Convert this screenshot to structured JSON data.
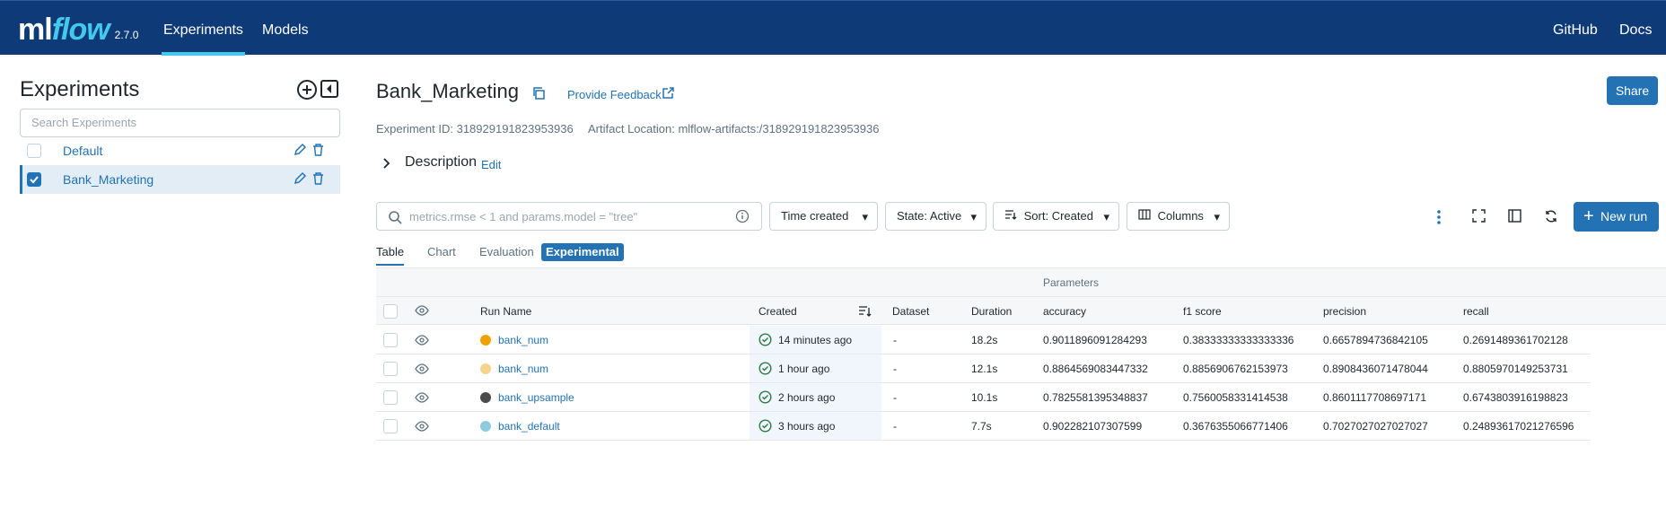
{
  "header": {
    "logo_ml": "ml",
    "logo_flow": "flow",
    "version": "2.7.0",
    "tabs": [
      {
        "label": "Experiments"
      },
      {
        "label": "Models"
      }
    ],
    "right_links": [
      {
        "label": "GitHub"
      },
      {
        "label": "Docs"
      }
    ]
  },
  "sidebar": {
    "title": "Experiments",
    "search_placeholder": "Search Experiments",
    "items": [
      {
        "label": "Default",
        "checked": false
      },
      {
        "label": "Bank_Marketing",
        "checked": true
      }
    ]
  },
  "experiment": {
    "title": "Bank_Marketing",
    "feedback_label": "Provide Feedback",
    "share_label": "Share",
    "id_text": "Experiment ID: 318929191823953936",
    "artifact_text": "Artifact Location: mlflow-artifacts:/318929191823953936",
    "description_label": "Description",
    "edit_label": "Edit"
  },
  "toolbar": {
    "search_placeholder": "metrics.rmse < 1 and params.model = \"tree\"",
    "time_created": "Time created",
    "state": "State: Active",
    "sort": "Sort: Created",
    "columns": "Columns",
    "new_run": "New run"
  },
  "view_tabs": {
    "table": "Table",
    "chart": "Chart",
    "evaluation": "Evaluation",
    "experimental": "Experimental"
  },
  "table": {
    "group_label": "Parameters",
    "headers": {
      "run_name": "Run Name",
      "created": "Created",
      "dataset": "Dataset",
      "duration": "Duration",
      "accuracy": "accuracy",
      "f1": "f1 score",
      "precision": "precision",
      "recall": "recall"
    },
    "rows": [
      {
        "name": "bank_num",
        "color": "#f2a200",
        "created": "14 minutes ago",
        "dataset": "-",
        "duration": "18.2s",
        "accuracy": "0.9011896091284293",
        "f1": "0.38333333333333336",
        "precision": "0.6657894736842105",
        "recall": "0.2691489361702128"
      },
      {
        "name": "bank_num",
        "color": "#f7d48e",
        "created": "1 hour ago",
        "dataset": "-",
        "duration": "12.1s",
        "accuracy": "0.8864569083447332",
        "f1": "0.8856906762153973",
        "precision": "0.8908436071478044",
        "recall": "0.8805970149253731"
      },
      {
        "name": "bank_upsample",
        "color": "#4a4a4a",
        "created": "2 hours ago",
        "dataset": "-",
        "duration": "10.1s",
        "accuracy": "0.7825581395348837",
        "f1": "0.7560058331414538",
        "precision": "0.8601117708697171",
        "recall": "0.6743803916198823"
      },
      {
        "name": "bank_default",
        "color": "#8ccbe0",
        "created": "3 hours ago",
        "dataset": "-",
        "duration": "7.7s",
        "accuracy": "0.902282107307599",
        "f1": "0.3676355066771406",
        "precision": "0.7027027027027027",
        "recall": "0.24893617021276596"
      }
    ]
  }
}
